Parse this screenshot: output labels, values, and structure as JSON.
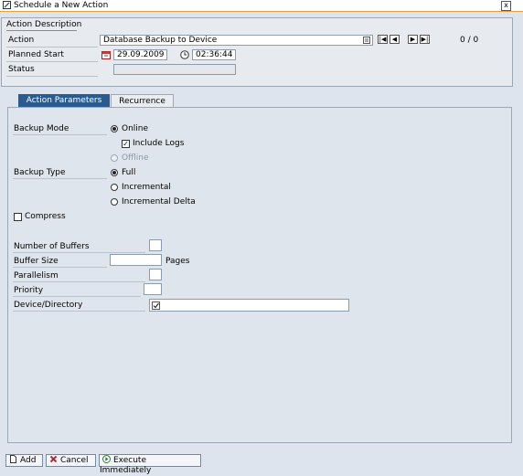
{
  "window": {
    "title": "Schedule a New Action",
    "close_glyph": "x"
  },
  "action_description": {
    "title": "Action Description",
    "action_label": "Action",
    "action_value": "Database Backup to Device",
    "counter": "0 / 0",
    "planned_start_label": "Planned Start",
    "date_value": "29.09.2009",
    "time_value": "02:36:44",
    "status_label": "Status",
    "status_value": ""
  },
  "tabs": [
    {
      "label": "Action Parameters",
      "active": true
    },
    {
      "label": "Recurrence",
      "active": false
    }
  ],
  "params": {
    "backup_mode_label": "Backup Mode",
    "online_label": "Online",
    "include_logs_label": "Include Logs",
    "offline_label": "Offline",
    "backup_type_label": "Backup Type",
    "full_label": "Full",
    "incremental_label": "Incremental",
    "incremental_delta_label": "Incremental Delta",
    "compress_label": "Compress",
    "num_buffers_label": "Number of Buffers",
    "num_buffers_value": "",
    "buffer_size_label": "Buffer Size",
    "buffer_size_value": "",
    "pages_label": "Pages",
    "parallelism_label": "Parallelism",
    "parallelism_value": "",
    "priority_label": "Priority",
    "priority_value": "",
    "device_label": "Device/Directory",
    "device_value": ""
  },
  "states": {
    "backup_mode": "online",
    "include_logs": true,
    "backup_type": "full",
    "compress": false
  },
  "footer": {
    "add_label": "Add",
    "cancel_label": "Cancel",
    "execute_label": "Execute Immediately"
  },
  "colors": {
    "accent_orange": "#e8a33d",
    "tab_active": "#2b5b8e",
    "panel_bg": "#e7ebf0",
    "page_bg": "#dde4ed"
  }
}
